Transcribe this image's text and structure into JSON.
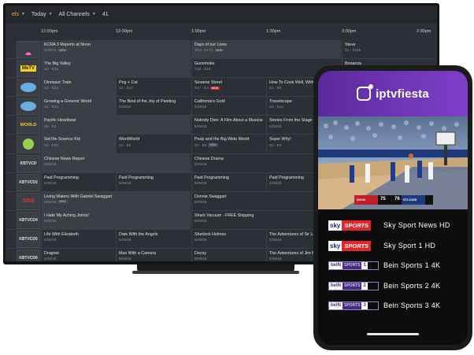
{
  "tv": {
    "toolbar": {
      "filter_partial": "els",
      "day": "Today",
      "channels": "All Channels",
      "count": "41"
    },
    "times": [
      "12:00pm",
      "12:30pm",
      "1:00pm",
      "1:30pm",
      "2:00pm",
      "2:30pm"
    ],
    "rows": [
      {
        "channel": "NBC HD",
        "logo": "nbc-logo",
        "cells": [
          {
            "title": "KCRA 3 Reports at Noon",
            "sub": "5/29/18",
            "badge": "NEW"
          },
          {
            "title": "Days of our Lives",
            "sub": "S53 · E173",
            "badge": "NEW"
          },
          {
            "title": "Steve",
            "sub": "S1 · E119"
          }
        ]
      },
      {
        "channel": "MeTV",
        "logo": "metv-logo",
        "cells": [
          {
            "title": "The Big Valley",
            "sub": "S2 · E25"
          },
          {
            "title": "Gunsmoke",
            "sub": "S18 · E19"
          },
          {
            "title": "Bonanza",
            "sub": ""
          }
        ]
      },
      {
        "channel": "PBS",
        "logo": "pbs-logo",
        "cells": [
          {
            "title": "Dinosaur Train",
            "sub": "S2 · E22"
          },
          {
            "title": "Peg + Cat",
            "sub": "S2 · E17"
          },
          {
            "title": "Sesame Street",
            "sub": "S47 · E4",
            "badge": "NEW",
            "badge_color": "red"
          },
          {
            "title": "How To Cook Well, With R",
            "sub": "S1 · E8"
          }
        ]
      },
      {
        "channel": "PBS",
        "logo": "pbs-logo",
        "cells": [
          {
            "title": "Growing a Greener World",
            "sub": "S1 · E12"
          },
          {
            "title": "The Best of the Joy of Painting",
            "sub": "5/29/18"
          },
          {
            "title": "California's Gold",
            "sub": "5/29/18"
          },
          {
            "title": "Travelscope",
            "sub": "S4 · E12"
          }
        ]
      },
      {
        "channel": "WORLD",
        "logo": "world-logo",
        "cells": [
          {
            "title": "Pacific Heartbeat",
            "sub": "S6 · E4"
          },
          {
            "title": "Nobody Dies: A Film About a Musicia",
            "sub": "5/29/18"
          },
          {
            "title": "Stories From the Stage",
            "sub": "5/26/18"
          }
        ]
      },
      {
        "channel": "PBS KIDS",
        "logo": "pbskids-logo",
        "cells": [
          {
            "title": "Sid the Science Kid",
            "sub": "S1 · E33"
          },
          {
            "title": "WordWorld",
            "sub": "S2 · E6"
          },
          {
            "title": "Peep and the Big Wide World",
            "sub": "S3 · E6",
            "badge": "NEW"
          },
          {
            "title": "Super Why!",
            "sub": "S3 · E3"
          }
        ]
      },
      {
        "channel": "KBTVCD",
        "logo": "text-logo",
        "cells": [
          {
            "title": "Chinese News Report",
            "sub": "5/29/18"
          },
          {
            "title": "Chinese Drama",
            "sub": "5/29/18"
          }
        ]
      },
      {
        "channel": "KBTVCD2",
        "logo": "text-logo",
        "cells": [
          {
            "title": "Paid Programming",
            "sub": "5/29/18"
          },
          {
            "title": "Paid Programming",
            "sub": "5/29/18"
          },
          {
            "title": "Paid Programming",
            "sub": "5/29/18"
          },
          {
            "title": "Paid Programming",
            "sub": "5/29/18"
          }
        ]
      },
      {
        "channel": "SBN",
        "logo": "sbn-logo",
        "cells": [
          {
            "title": "Living Waters With Gabriel Swaggart",
            "sub": "5/29/18",
            "badge": "NEW"
          },
          {
            "title": "Donnie Swaggart",
            "sub": "5/29/18"
          }
        ]
      },
      {
        "channel": "KBTVCD4",
        "logo": "text-logo",
        "cells": [
          {
            "title": "I Hate My Aching Joints!",
            "sub": "5/29/18"
          },
          {
            "title": "Shark Vacuum - FREE Shipping",
            "sub": "5/29/18"
          }
        ]
      },
      {
        "channel": "KBTVCD5",
        "logo": "text-logo",
        "cells": [
          {
            "title": "Life With Elizabeth",
            "sub": "5/29/18"
          },
          {
            "title": "Date With the Angels",
            "sub": "5/29/18"
          },
          {
            "title": "Sherlock Holmes",
            "sub": "5/29/18"
          },
          {
            "title": "The Adventures of Sir Lan",
            "sub": "5/29/18"
          }
        ]
      },
      {
        "channel": "KBTVCD6",
        "logo": "text-logo",
        "cells": [
          {
            "title": "Dragnet",
            "sub": "5/29/18"
          },
          {
            "title": "Man With a Camera",
            "sub": "5/29/18"
          },
          {
            "title": "Decoy",
            "sub": "5/29/18"
          },
          {
            "title": "The Adventures of Jim Bo",
            "sub": "5/29/18"
          }
        ]
      }
    ]
  },
  "phone": {
    "app_name": "iptvfiesta",
    "scoreboard": {
      "team1": "NOVA",
      "score1": "75",
      "team2": "STLOUIS",
      "score2": "76"
    },
    "channels": [
      {
        "logo": "sky-sports",
        "logo_text_a": "sky",
        "logo_text_b": "SPORTS",
        "name": "Sky Sport News HD"
      },
      {
        "logo": "sky-sports",
        "logo_text_a": "sky",
        "logo_text_b": "SPORTS",
        "name": "Sky Sport 1 HD"
      },
      {
        "logo": "bein-sports",
        "logo_text_a": "beIN",
        "logo_text_b": "SPORTS",
        "logo_num": "1",
        "name": "Bein Sports 1 4K"
      },
      {
        "logo": "bein-sports",
        "logo_text_a": "beIN",
        "logo_text_b": "SPORTS",
        "logo_num": "2",
        "name": "Bein Sports 2 4K"
      },
      {
        "logo": "bein-sports",
        "logo_text_a": "beIN",
        "logo_text_b": "SPORTS",
        "logo_num": "3",
        "name": "Bein Sports 3 4K"
      }
    ]
  },
  "colors": {
    "accent": "#7f3fc8",
    "tv_bg": "#2c3036",
    "highlight": "#f0a93c"
  }
}
